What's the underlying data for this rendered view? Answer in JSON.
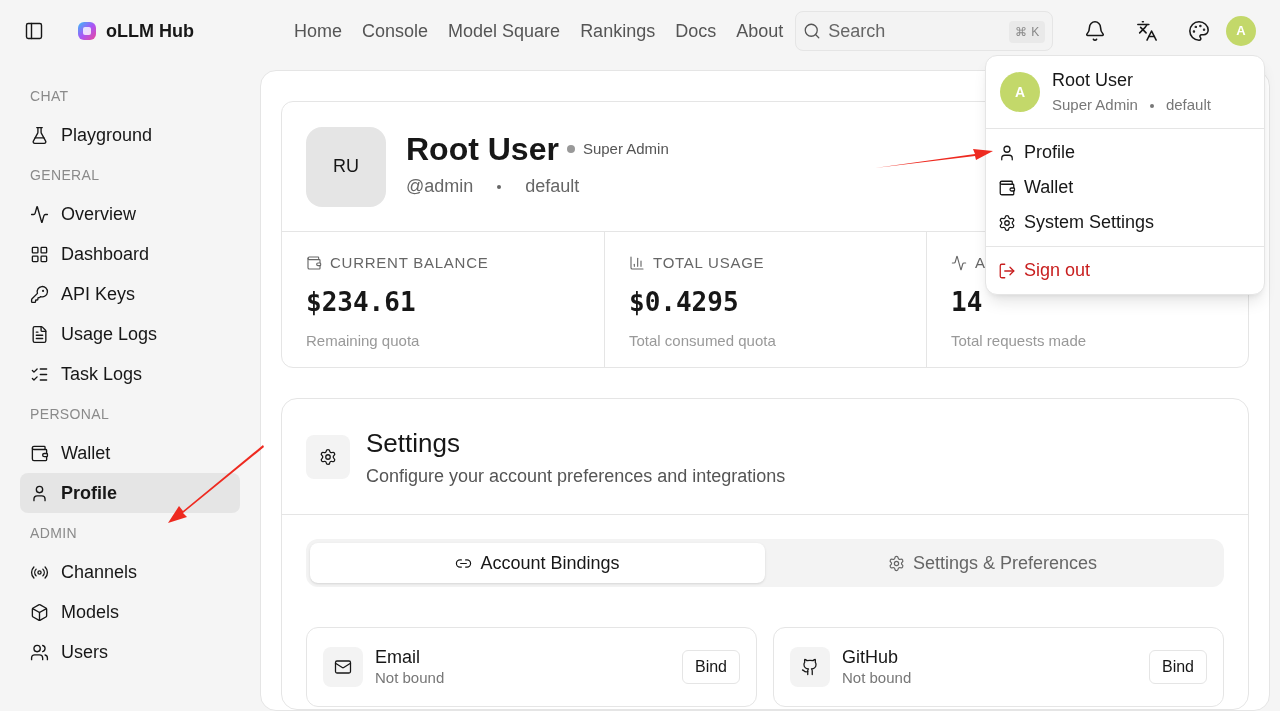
{
  "brand": {
    "name": "oLLM Hub"
  },
  "nav": [
    {
      "label": "Home"
    },
    {
      "label": "Console"
    },
    {
      "label": "Model Square"
    },
    {
      "label": "Rankings"
    },
    {
      "label": "Docs"
    },
    {
      "label": "About"
    }
  ],
  "search": {
    "placeholder": "Search",
    "shortcut": [
      "⌘",
      "K"
    ]
  },
  "avatar": {
    "initial": "A"
  },
  "sidebar": {
    "sections": [
      {
        "title": "CHAT",
        "items": [
          {
            "label": "Playground",
            "selected": false
          }
        ]
      },
      {
        "title": "GENERAL",
        "items": [
          {
            "label": "Overview",
            "selected": false
          },
          {
            "label": "Dashboard",
            "selected": false
          },
          {
            "label": "API Keys",
            "selected": false
          },
          {
            "label": "Usage Logs",
            "selected": false
          },
          {
            "label": "Task Logs",
            "selected": false
          }
        ]
      },
      {
        "title": "PERSONAL",
        "items": [
          {
            "label": "Wallet",
            "selected": false
          },
          {
            "label": "Profile",
            "selected": true
          }
        ]
      },
      {
        "title": "ADMIN",
        "items": [
          {
            "label": "Channels",
            "selected": false
          },
          {
            "label": "Models",
            "selected": false
          },
          {
            "label": "Users",
            "selected": false
          }
        ]
      }
    ]
  },
  "profile": {
    "initials": "RU",
    "name": "Root User",
    "role": "Super Admin",
    "username": "@admin",
    "group": "default"
  },
  "stats": [
    {
      "label": "CURRENT BALANCE",
      "value": "$234.61",
      "caption": "Remaining quota"
    },
    {
      "label": "TOTAL USAGE",
      "value": "$0.4295",
      "caption": "Total consumed quota"
    },
    {
      "label": "A",
      "value": "14",
      "caption": "Total requests made"
    }
  ],
  "settings": {
    "title": "Settings",
    "subtitle": "Configure your account preferences and integrations",
    "tabs": [
      {
        "label": "Account Bindings",
        "selected": true
      },
      {
        "label": "Settings & Preferences",
        "selected": false
      }
    ],
    "bindings": [
      {
        "name": "Email",
        "status": "Not bound",
        "action": "Bind"
      },
      {
        "name": "GitHub",
        "status": "Not bound",
        "action": "Bind"
      }
    ]
  },
  "menu": {
    "initial": "A",
    "name": "Root User",
    "role": "Super Admin",
    "group": "default",
    "items": [
      {
        "label": "Profile",
        "kind": "normal"
      },
      {
        "label": "Wallet",
        "kind": "normal"
      },
      {
        "label": "System Settings",
        "kind": "normal"
      },
      {
        "label": "Sign out",
        "kind": "danger"
      }
    ]
  }
}
